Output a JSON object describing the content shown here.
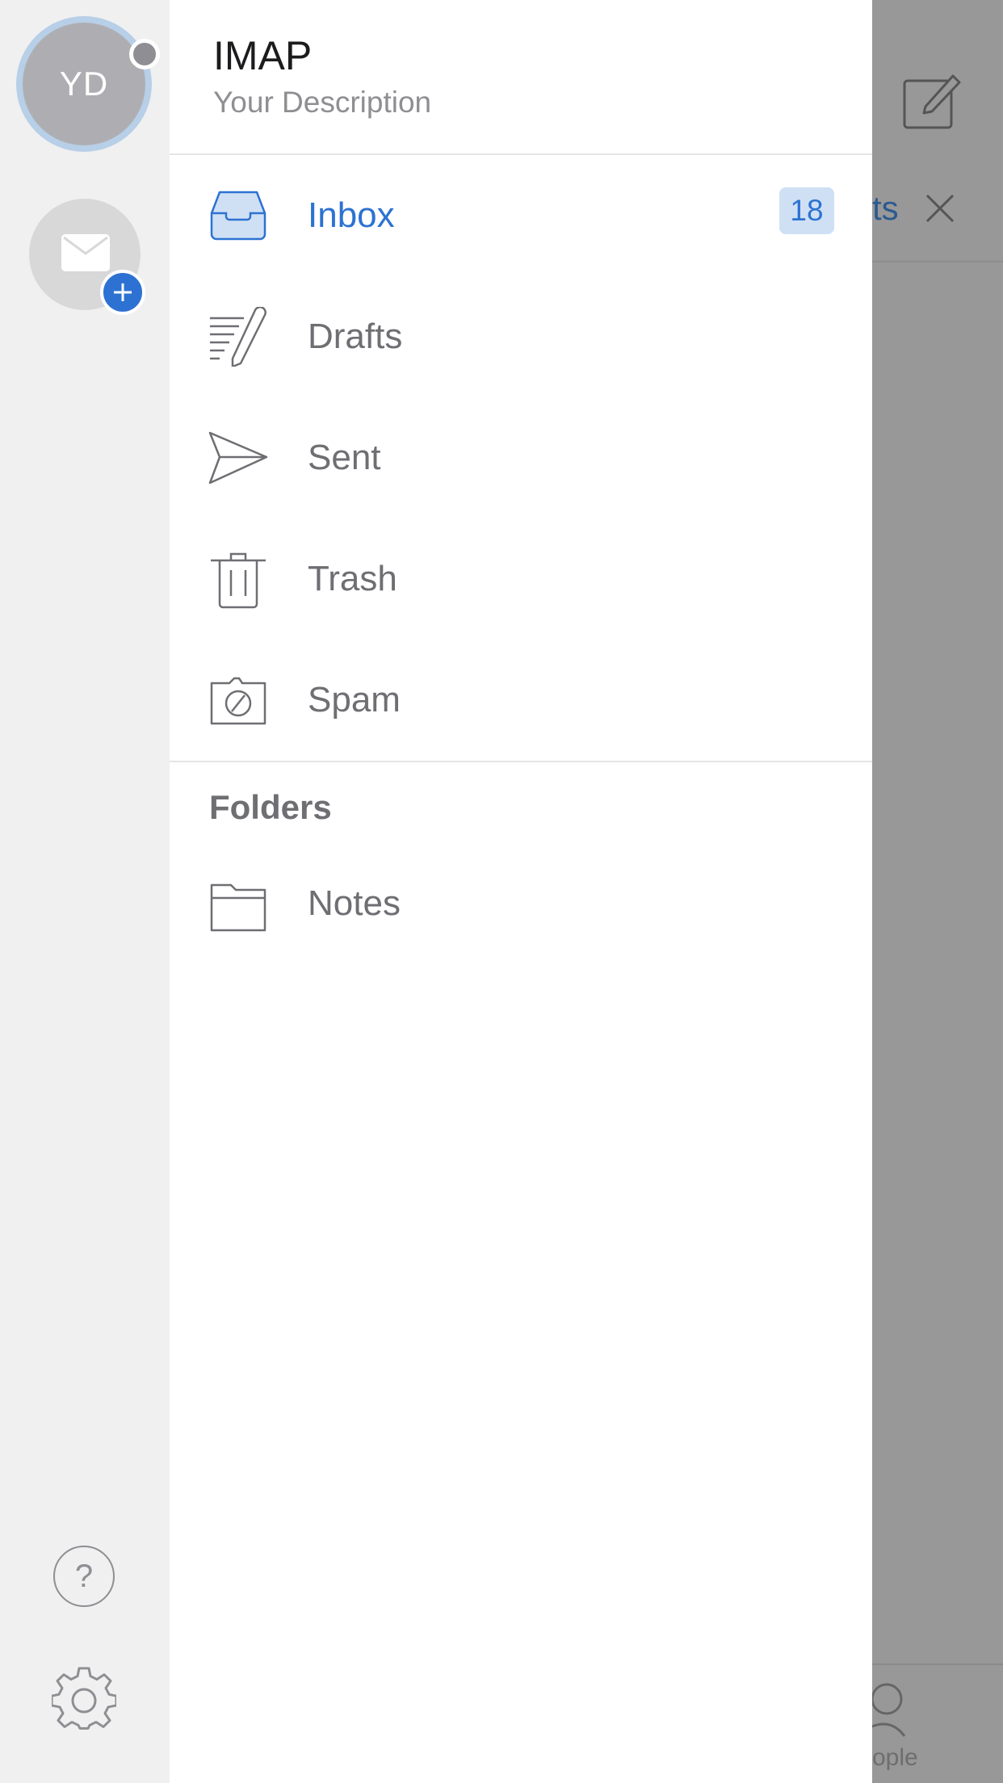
{
  "account": {
    "initials": "YD",
    "name": "IMAP",
    "description": "Your Description"
  },
  "rail": {
    "add_account_icon": "mail-add-icon",
    "help_glyph": "?",
    "help_icon": "help-icon",
    "settings_icon": "gear-icon"
  },
  "folders": [
    {
      "label": "Inbox",
      "icon": "inbox-icon",
      "badge": "18",
      "selected": true
    },
    {
      "label": "Drafts",
      "icon": "drafts-icon"
    },
    {
      "label": "Sent",
      "icon": "sent-icon"
    },
    {
      "label": "Trash",
      "icon": "trash-icon"
    },
    {
      "label": "Spam",
      "icon": "spam-icon"
    }
  ],
  "folders_section": {
    "title": "Folders",
    "items": [
      {
        "label": "Notes",
        "icon": "folder-icon"
      }
    ]
  },
  "background": {
    "filter_label": "ts",
    "tab_label": "ople"
  },
  "colors": {
    "accent": "#2d72d2",
    "badge_bg": "#cfe0f5",
    "rail_bg": "#f0f0f0",
    "overlay": "#989898"
  }
}
